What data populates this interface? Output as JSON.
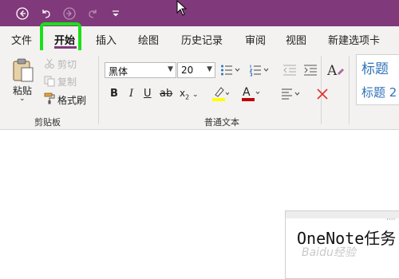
{
  "tabs": [
    "文件",
    "开始",
    "插入",
    "绘图",
    "历史记录",
    "审阅",
    "视图",
    "新建选项卡"
  ],
  "clipboard": {
    "paste_label": "粘贴",
    "cut_label": "剪切",
    "copy_label": "复制",
    "format_painter_label": "格式刷",
    "group_label": "剪贴板"
  },
  "basic_text": {
    "font_name": "黑体",
    "font_size": "20",
    "group_label": "普通文本"
  },
  "styles": {
    "heading1": "标题",
    "heading2": "标题 2"
  },
  "note": {
    "text": "OneNote任务"
  },
  "watermark": {
    "text": "Baidu经验"
  },
  "colors": {
    "accent": "#80397b",
    "highlight_box": "#19e019",
    "highlighter": "#ffff00",
    "font_color": "#c00000"
  }
}
